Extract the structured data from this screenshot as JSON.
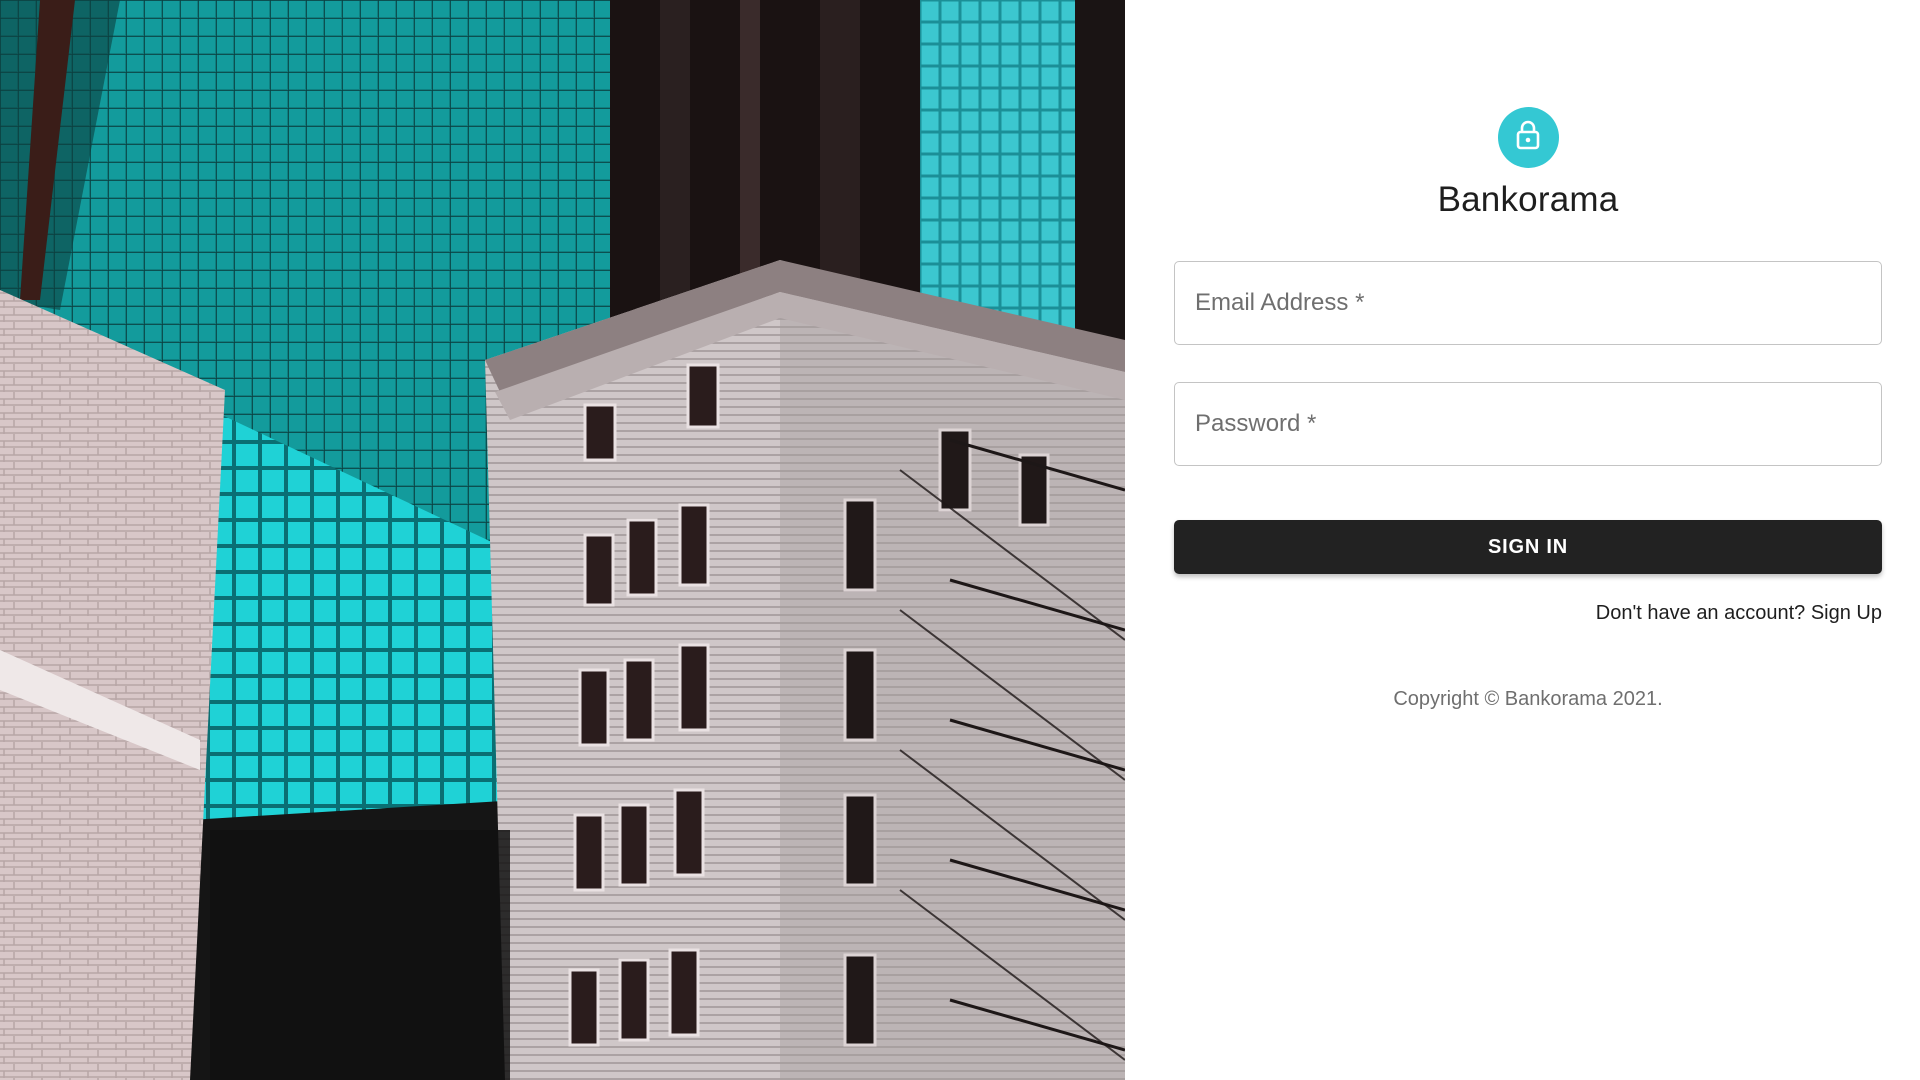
{
  "hero": {
    "image_description_icon": "city-buildings-photo"
  },
  "header": {
    "avatar_icon": "lock-icon",
    "avatar_color": "#34c8d3",
    "brand": "Bankorama"
  },
  "form": {
    "email_placeholder": "Email Address *",
    "email_value": "",
    "password_placeholder": "Password *",
    "password_value": "",
    "submit_label": "SIGN IN",
    "submit_color": "#222222",
    "signup_link": "Don't have an account? Sign Up"
  },
  "footer": {
    "copyright": "Copyright © Bankorama 2021."
  }
}
